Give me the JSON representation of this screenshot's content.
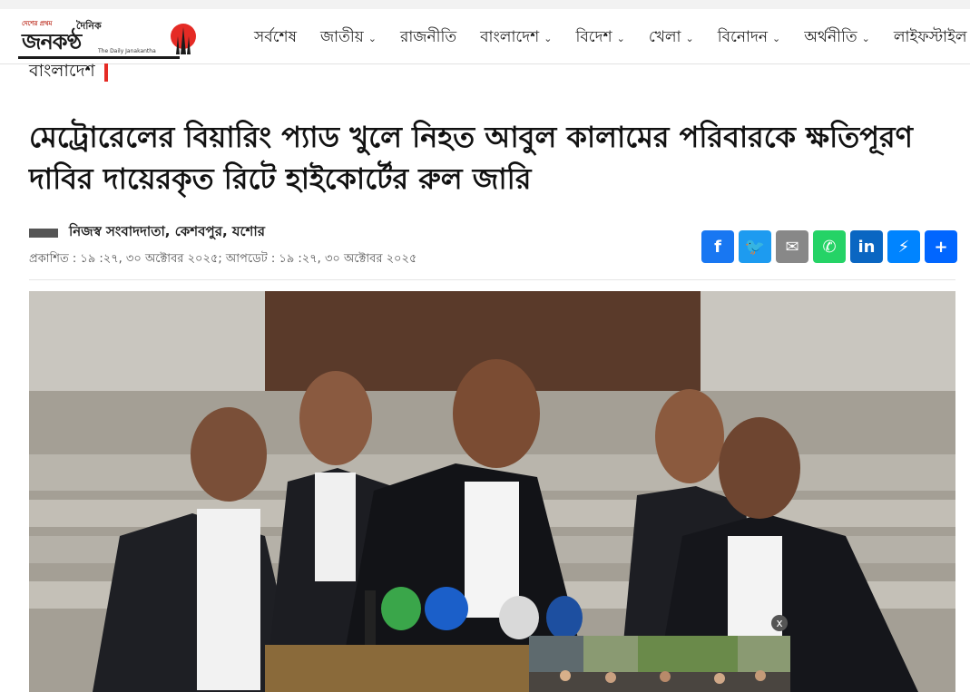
{
  "site": {
    "logo_tagline": "দেশের প্রথম",
    "logo_dainik": "দৈনিক",
    "logo_name": "জনকণ্ঠ",
    "logo_english": "The Daily Janakantha"
  },
  "nav": {
    "items": [
      {
        "label": "সর্বশেষ",
        "has_dropdown": false
      },
      {
        "label": "জাতীয়",
        "has_dropdown": true
      },
      {
        "label": "রাজনীতি",
        "has_dropdown": false
      },
      {
        "label": "বাংলাদেশ",
        "has_dropdown": true
      },
      {
        "label": "বিদেশ",
        "has_dropdown": true
      },
      {
        "label": "খেলা",
        "has_dropdown": true
      },
      {
        "label": "বিনোদন",
        "has_dropdown": true
      },
      {
        "label": "অর্থনীতি",
        "has_dropdown": true
      },
      {
        "label": "লাইফস্টাইল",
        "has_dropdown": false
      }
    ]
  },
  "article": {
    "section": "বাংলাদেশ",
    "headline": "মেট্রোরেলের বিয়ারিং প্যাড খুলে নিহত আবুল কালামের পরিবারকে ক্ষতিপূরণ দাবির দায়েরকৃত রিটে হাইকোর্টের রুল জারি",
    "author": "নিজস্ব সংবাদদাতা, কেশবপুর, যশোর",
    "dates": "প্রকাশিত : ১৯ :২৭, ৩০ অক্টোবর ২০২৫; আপডেট : ১৯ :২৭, ৩০ অক্টোবর ২০২৫"
  },
  "share": [
    {
      "name": "facebook-icon",
      "glyph": "f",
      "color": "#1877f2"
    },
    {
      "name": "twitter-icon",
      "glyph": "🐦",
      "color": "#1d9bf0"
    },
    {
      "name": "email-icon",
      "glyph": "✉",
      "color": "#888888"
    },
    {
      "name": "whatsapp-icon",
      "glyph": "✆",
      "color": "#25d366"
    },
    {
      "name": "linkedin-icon",
      "glyph": "in",
      "color": "#0a66c2"
    },
    {
      "name": "messenger-icon",
      "glyph": "⚡",
      "color": "#0084ff"
    },
    {
      "name": "share-more-icon",
      "glyph": "+",
      "color": "#0166ff"
    }
  ],
  "video_close": "x"
}
